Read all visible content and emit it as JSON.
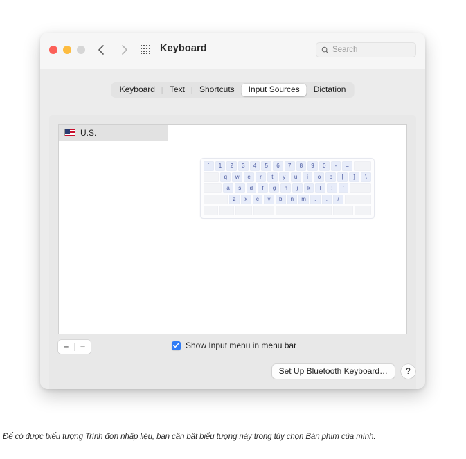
{
  "window": {
    "title": "Keyboard",
    "traffic_lights": [
      "close",
      "minimize",
      "zoom"
    ],
    "nav_back_icon": "chevron-left-icon",
    "nav_forward_icon": "chevron-right-icon",
    "grid_icon": "apps-grid-icon",
    "search": {
      "icon": "search-icon",
      "placeholder": "Search",
      "value": ""
    }
  },
  "tabs": [
    {
      "label": "Keyboard",
      "active": false
    },
    {
      "label": "Text",
      "active": false
    },
    {
      "label": "Shortcuts",
      "active": false
    },
    {
      "label": "Input Sources",
      "active": true
    },
    {
      "label": "Dictation",
      "active": false
    }
  ],
  "sidebar": {
    "items": [
      {
        "label": "U.S.",
        "icon": "us-flag-icon",
        "selected": true
      }
    ],
    "add_label": "+",
    "remove_label": "−"
  },
  "keyboard_preview": {
    "rows": [
      [
        "`",
        "1",
        "2",
        "3",
        "4",
        "5",
        "6",
        "7",
        "8",
        "9",
        "0",
        "-",
        "=",
        ""
      ],
      [
        "",
        "q",
        "w",
        "e",
        "r",
        "t",
        "y",
        "u",
        "i",
        "o",
        "p",
        "[",
        "]",
        "\\"
      ],
      [
        "",
        "a",
        "s",
        "d",
        "f",
        "g",
        "h",
        "j",
        "k",
        "l",
        ";",
        "'",
        ""
      ],
      [
        "",
        "z",
        "x",
        "c",
        "v",
        "b",
        "n",
        "m",
        ",",
        ".",
        "/",
        ""
      ],
      [
        "",
        "",
        "",
        "",
        "",
        "",
        ""
      ]
    ]
  },
  "options": {
    "show_input_menu": {
      "label": "Show Input menu in menu bar",
      "checked": true
    }
  },
  "footer": {
    "bluetooth_button": "Set Up Bluetooth Keyboard…",
    "help_button": "?"
  },
  "caption": "Để có được biểu tượng Trình đơn nhập liệu, bạn cần bật biểu tượng này trong tùy chọn Bàn phím của mình.",
  "colors": {
    "accent": "#2f7cf6",
    "close": "#fc6058",
    "minimize": "#fdbc40",
    "zoom": "#d6d6d6",
    "key_text": "#4b5ba0"
  }
}
